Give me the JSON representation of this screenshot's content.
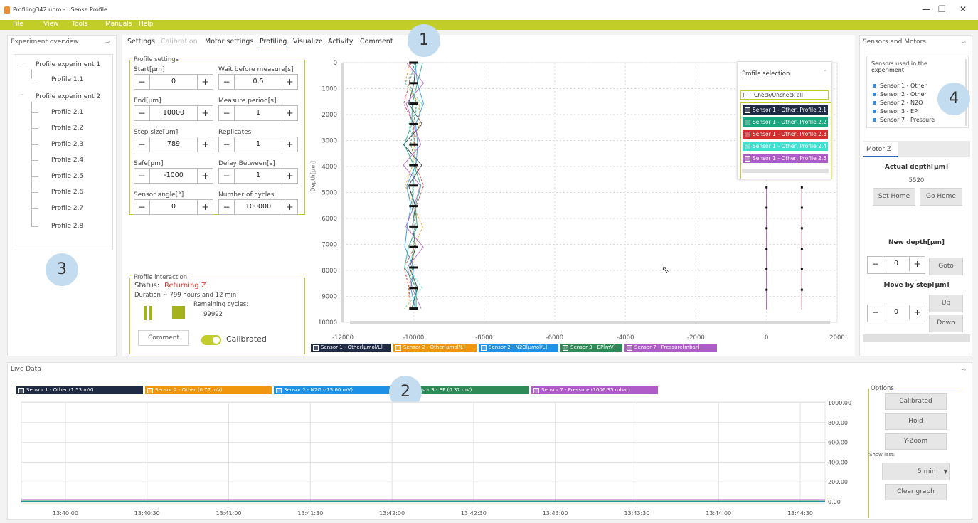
{
  "window": {
    "title": "Profiling342.upro - uSense Profile",
    "minimize": "—",
    "restore": "❐",
    "close": "✕"
  },
  "menu": [
    "File",
    "View",
    "Tools",
    "Manuals",
    "Help"
  ],
  "experiment_overview": {
    "header": "Experiment overview",
    "tree": [
      {
        "label": "Profile experiment 1",
        "children": [
          "Profile 1.1"
        ]
      },
      {
        "label": "Profile experiment 2",
        "children": [
          "Profile 2.1",
          "Profile 2.2",
          "Profile 2.3",
          "Profile 2.4",
          "Profile 2.5",
          "Profile 2.6",
          "Profile 2.7",
          "Profile 2.8"
        ]
      }
    ]
  },
  "tabs": [
    {
      "label": "Settings",
      "state": "normal"
    },
    {
      "label": "Calibration",
      "state": "disabled"
    },
    {
      "label": "Motor settings",
      "state": "normal"
    },
    {
      "label": "Profiling",
      "state": "active"
    },
    {
      "label": "Visualize",
      "state": "normal"
    },
    {
      "label": "Activity",
      "state": "normal"
    },
    {
      "label": "Comment",
      "state": "normal"
    }
  ],
  "profile_settings": {
    "legend": "Profile settings",
    "fields": [
      {
        "label": "Start[µm]",
        "value": "0"
      },
      {
        "label": "Wait before measure[s]",
        "value": "0.5"
      },
      {
        "label": "End[µm]",
        "value": "10000"
      },
      {
        "label": "Measure period[s]",
        "value": "1"
      },
      {
        "label": "Step size[µm]",
        "value": "789"
      },
      {
        "label": "Replicates",
        "value": "1"
      },
      {
        "label": "Safe[µm]",
        "value": "-1000"
      },
      {
        "label": "Delay Between[s]",
        "value": "1"
      },
      {
        "label": "Sensor angle[°]",
        "value": "0"
      },
      {
        "label": "Number of cycles",
        "value": "100000"
      }
    ],
    "minus": "−",
    "plus": "+"
  },
  "profile_interaction": {
    "legend": "Profile interaction",
    "status_label": "Status:",
    "status_value": "Returning Z",
    "duration": "Duration ~ 799 hours and 12 min",
    "remaining_label": "Remaining cycles:",
    "remaining_value": "99992",
    "comment_button": "Comment",
    "calibrated_label": "Calibrated",
    "calibrated_on": true
  },
  "profile_chart": {
    "ylabel": "Depth[µm]",
    "yticks": [
      "0",
      "1000",
      "2000",
      "3000",
      "4000",
      "5000",
      "6000",
      "7000",
      "8000",
      "9000",
      "10000"
    ],
    "xticks": [
      "-12000",
      "-10000",
      "-8000",
      "-6000",
      "-4000",
      "-2000",
      "0",
      "2000"
    ],
    "legend": [
      {
        "label": "Sensor 1 - Other[µmol/L]",
        "color": "#1f2a44"
      },
      {
        "label": "Sensor 2 - Other[µmol/L]",
        "color": "#f0960e"
      },
      {
        "label": "Sensor 2 - N2O[µmol/L]",
        "color": "#1e90e6"
      },
      {
        "label": "Sensor 3 - EP[mV]",
        "color": "#2e8b57"
      },
      {
        "label": "Sensor 7 - Pressure[mbar]",
        "color": "#b05cc8"
      }
    ],
    "selection": {
      "title": "Profile selection",
      "check_all": "Check/Uncheck all",
      "items": [
        {
          "label": "Sensor 1 - Other, Profile 2.1",
          "color": "#1f2a44"
        },
        {
          "label": "Sensor 1 - Other, Profile 2.2",
          "color": "#1aa77f"
        },
        {
          "label": "Sensor 1 - Other, Profile 2.3",
          "color": "#d32f2f"
        },
        {
          "label": "Sensor 1 - Other, Profile 2.4",
          "color": "#40e0d0"
        },
        {
          "label": "Sensor 1 - Other, Profile 2.5",
          "color": "#b05cc8"
        }
      ]
    }
  },
  "sensors_motors": {
    "header": "Sensors and Motors",
    "list_title": "Sensors used in the experiment",
    "sensors": [
      "Sensor 1 - Other",
      "Sensor 2 - Other",
      "Sensor 2 - N2O",
      "Sensor 3 - EP",
      "Sensor 7 - Pressure"
    ],
    "motor_tab": "Motor Z",
    "actual_depth_label": "Actual depth[µm]",
    "actual_depth_value": "5520",
    "set_home": "Set Home",
    "go_home": "Go Home",
    "new_depth_label": "New depth[µm]",
    "new_depth_value": "0",
    "goto": "Goto",
    "move_step_label": "Move by step[µm]",
    "move_step_value": "0",
    "up": "Up",
    "down": "Down"
  },
  "live_data": {
    "header": "Live Data",
    "series": [
      {
        "label": "Sensor 1 - Other (1.53 mV)",
        "color": "#1f2a44"
      },
      {
        "label": "Sensor 2 - Other (0.77 mV)",
        "color": "#f0960e"
      },
      {
        "label": "Sensor 2 - N2O (-15.60 mV)",
        "color": "#1e90e6"
      },
      {
        "label": "Sensor 3 - EP (0.37 mV)",
        "color": "#2e8b57"
      },
      {
        "label": "Sensor 7 - Pressure (1006.35 mbar)",
        "color": "#b05cc8"
      }
    ],
    "xticks": [
      "13:40:00",
      "13:40:30",
      "13:41:00",
      "13:41:30",
      "13:42:00",
      "13:42:30",
      "13:43:00",
      "13:43:30",
      "13:44:00",
      "13:44:30"
    ],
    "yticks": [
      "1000.00",
      "800.00",
      "600.00",
      "400.00",
      "200.00",
      "0.00"
    ],
    "options": {
      "legend": "Options",
      "calibrated": "Calibrated",
      "hold": "Hold",
      "yzoom": "Y-Zoom",
      "show_last": "Show last:",
      "show_last_value": "5 min",
      "clear": "Clear graph"
    }
  },
  "badges": [
    "1",
    "2",
    "3",
    "4"
  ]
}
